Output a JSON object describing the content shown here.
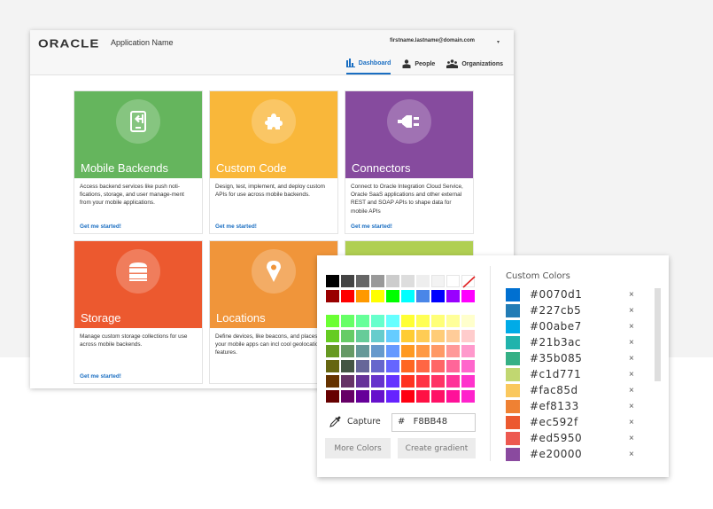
{
  "app": {
    "logo": "ORACLE",
    "app_name": "Application Name",
    "user_email": "firstname.lastname@domain.com",
    "user_caret": "▾",
    "nav": [
      {
        "label": "Dashboard",
        "icon": "bar-chart-icon",
        "active": true
      },
      {
        "label": "People",
        "icon": "person-icon",
        "active": false
      },
      {
        "label": "Organizations",
        "icon": "group-icon",
        "active": false
      }
    ],
    "cards": [
      {
        "title": "Mobile Backends",
        "icon": "mobile-backend-icon",
        "color": "#65b55d",
        "description": "Access backend services like push noti-fications, storage, and user manage-ment from your mobile applications.",
        "link": "Get me started!"
      },
      {
        "title": "Custom Code",
        "icon": "puzzle-icon",
        "color": "#f9b73a",
        "description": "Design, test, implement, and deploy custom APIs for use across mobile backends.",
        "link": "Get me started!"
      },
      {
        "title": "Connectors",
        "icon": "plug-icon",
        "color": "#864b9e",
        "description": "Connect to Oracle Integration Cloud Service, Oracle SaaS applications and other external REST and SOAP APIs to shape data for mobile APIs",
        "link": "Get me started!"
      },
      {
        "title": "Storage",
        "icon": "database-icon",
        "color": "#ec592f",
        "description": "Manage custom storage collections for use across mobile backends.",
        "link": "Get me started!"
      },
      {
        "title": "Locations",
        "icon": "location-pin-icon",
        "color": "#f0953a",
        "description": "Define devices, like beacons, and places so your mobile apps can incl cool geolocations features.",
        "link": ""
      },
      {
        "title": "",
        "icon": "",
        "color": "#b0cf52",
        "description": "",
        "link": ""
      }
    ]
  },
  "picker": {
    "basic_rows": [
      [
        "#000000",
        "#444444",
        "#666666",
        "#999999",
        "#cccccc",
        "#dddddd",
        "#eeeeee",
        "#f3f3f3",
        "#ffffff",
        "none"
      ],
      [
        "#990000",
        "#ff0000",
        "#ff9900",
        "#ffff00",
        "#00ff00",
        "#00ffff",
        "#4a86e8",
        "#0000ff",
        "#9900ff",
        "#ff00ff"
      ]
    ],
    "grid_rows": [
      [
        "#6bff33",
        "#66ff66",
        "#66ff99",
        "#66ffcc",
        "#66ffff",
        "#ffff33",
        "#ffff55",
        "#ffff77",
        "#ffff99",
        "#ffffcc"
      ],
      [
        "#66cc22",
        "#66cc66",
        "#66cc99",
        "#66cccc",
        "#66ccff",
        "#ffcc33",
        "#ffcc55",
        "#ffcc77",
        "#ffcc99",
        "#ffcccc"
      ],
      [
        "#669922",
        "#669966",
        "#669999",
        "#6699cc",
        "#6699ff",
        "#ff9922",
        "#ff9944",
        "#ff9966",
        "#ff9999",
        "#ff99cc"
      ],
      [
        "#666611",
        "#445544",
        "#666699",
        "#6666cc",
        "#6666ff",
        "#ff6622",
        "#ff6644",
        "#ff6666",
        "#ff6699",
        "#ff66cc"
      ],
      [
        "#663300",
        "#663366",
        "#663399",
        "#6633cc",
        "#6633ff",
        "#ff3322",
        "#ff3344",
        "#ff3366",
        "#ff3399",
        "#ff33cc"
      ],
      [
        "#660000",
        "#660066",
        "#660099",
        "#6611cc",
        "#6622ff",
        "#ff0011",
        "#ff1144",
        "#ff1166",
        "#ff1199",
        "#ff22cc"
      ]
    ],
    "capture_label": "Capture",
    "hex_prefix": "#",
    "hex_value": "F8BB48",
    "more_colors_label": "More Colors",
    "create_gradient_label": "Create gradient",
    "custom_colors_title": "Custom Colors",
    "custom_colors": [
      {
        "hex": "#0070d1",
        "swatch": "#0070d1"
      },
      {
        "hex": "#227cb5",
        "swatch": "#227cb5"
      },
      {
        "hex": "#00abe7",
        "swatch": "#00abe7"
      },
      {
        "hex": "#21b3ac",
        "swatch": "#21b3ac"
      },
      {
        "hex": "#35b085",
        "swatch": "#35b085"
      },
      {
        "hex": "#c1d771",
        "swatch": "#c1d771"
      },
      {
        "hex": "#fac85d",
        "swatch": "#fac85d"
      },
      {
        "hex": "#ef8133",
        "swatch": "#ef8133"
      },
      {
        "hex": "#ec592f",
        "swatch": "#ec592f"
      },
      {
        "hex": "#ed5950",
        "swatch": "#ed5950"
      },
      {
        "hex": "#e20000",
        "swatch": "#8a4a9f"
      }
    ],
    "remove_glyph": "×"
  }
}
